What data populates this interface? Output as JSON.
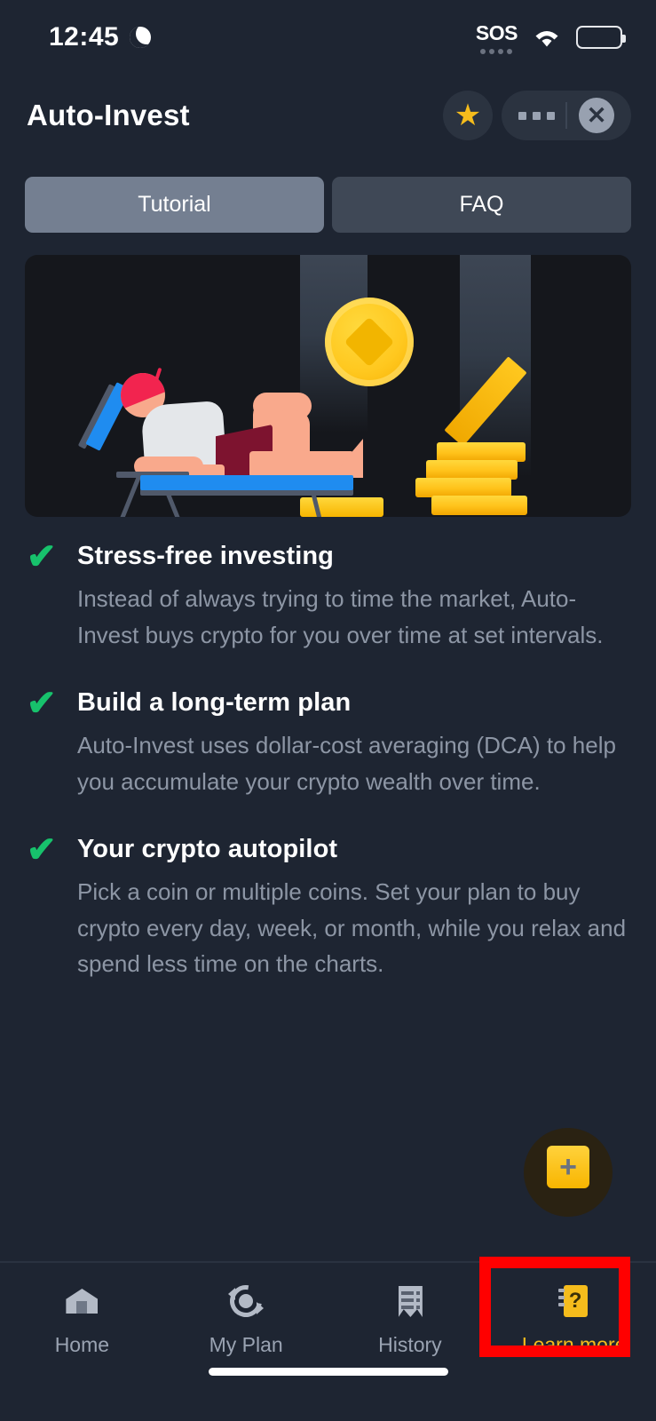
{
  "status_bar": {
    "time": "12:45",
    "moon_icon": "moon-icon",
    "sos_label": "SOS",
    "wifi_icon": "wifi-icon",
    "battery_icon": "battery-icon"
  },
  "header": {
    "title": "Auto-Invest",
    "star_icon": "★",
    "more_icon": "more-icon",
    "close_icon": "✕"
  },
  "tabs": [
    {
      "label": "Tutorial",
      "active": true
    },
    {
      "label": "FAQ",
      "active": false
    }
  ],
  "hero": {
    "alt": "illustration of a person relaxing on a lounge chair with gold coins"
  },
  "features": [
    {
      "check_icon": "✔",
      "title": "Stress-free investing",
      "description": "Instead of always trying to time the market, Auto-Invest buys crypto for you over time at set intervals."
    },
    {
      "check_icon": "✔",
      "title": "Build a long-term plan",
      "description": "Auto-Invest uses dollar-cost averaging (DCA) to help you accumulate your crypto wealth over time."
    },
    {
      "check_icon": "✔",
      "title": "Your crypto autopilot",
      "description": "Pick a coin or multiple coins. Set your plan to buy crypto every day, week, or month, while you relax and spend less time on the charts."
    }
  ],
  "fab": {
    "label": "+",
    "icon": "plus-icon"
  },
  "bottom_nav": [
    {
      "label": "Home",
      "icon": "home-icon",
      "active": false
    },
    {
      "label": "My Plan",
      "icon": "sync-plan-icon",
      "active": false
    },
    {
      "label": "History",
      "icon": "receipt-icon",
      "active": false
    },
    {
      "label": "Learn more",
      "icon": "question-book-icon",
      "active": true
    }
  ],
  "colors": {
    "background": "#1e2532",
    "hero_background": "#15171c",
    "accent_yellow": "#f5bc1c",
    "check_green": "#17c26c",
    "tab_active": "#747f91",
    "tab_inactive": "#3f4856",
    "text_primary": "#ffffff",
    "text_secondary": "#8d96a5",
    "highlight_red": "#ff0000"
  }
}
